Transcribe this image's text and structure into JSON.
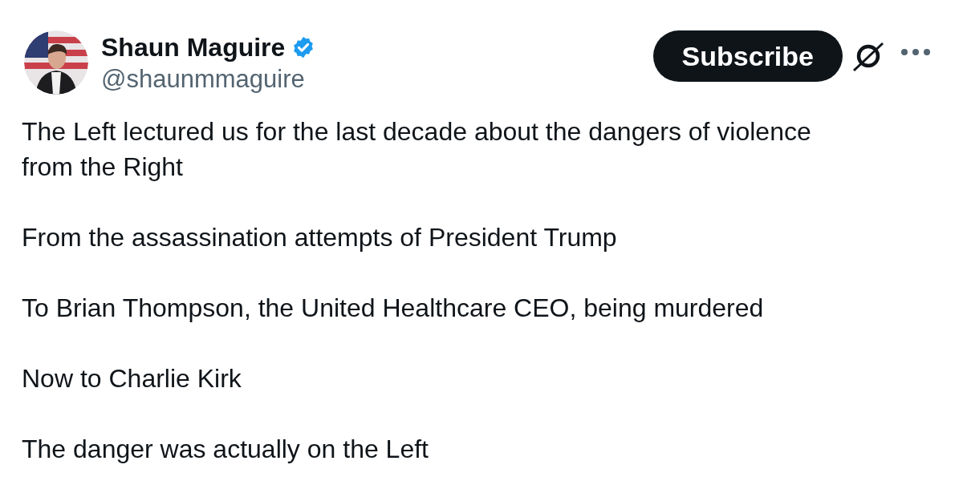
{
  "author": {
    "name": "Shaun Maguire",
    "verified": true,
    "handle": "@shaunmmaguire"
  },
  "actions": {
    "subscribe": "Subscribe"
  },
  "paragraphs": [
    "The Left lectured us for the last decade about the dangers of violence from the Right",
    "From the assassination attempts of President Trump",
    "To Brian Thompson, the United Healthcare CEO, being murdered",
    "Now to Charlie Kirk",
    "The danger was actually on the Left"
  ]
}
